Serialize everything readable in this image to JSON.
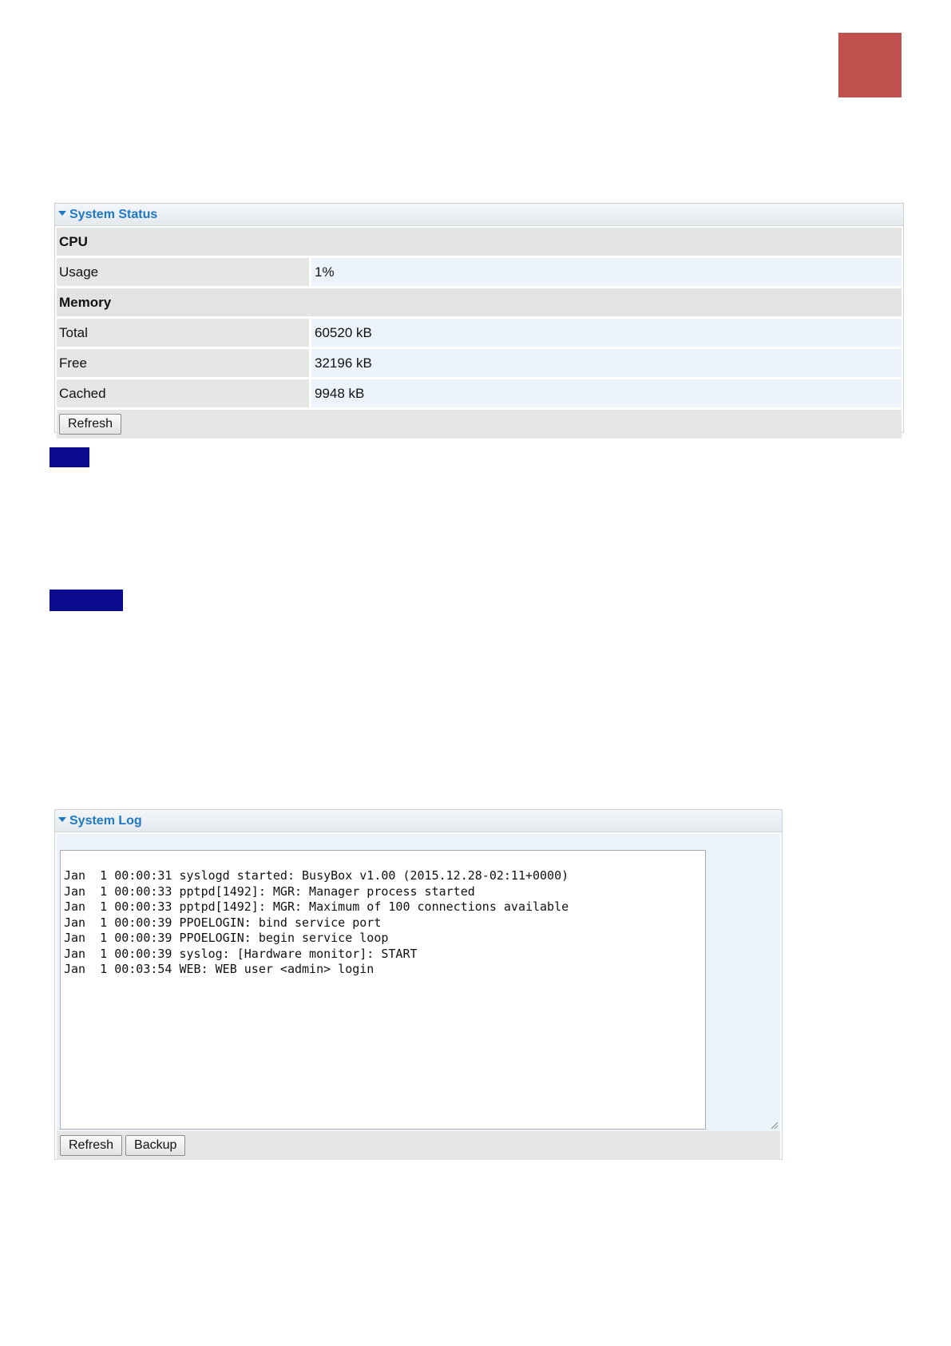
{
  "status_panel": {
    "title": "System Status",
    "cpu": {
      "section_label": "CPU",
      "usage_label": "Usage",
      "usage_value": "1%"
    },
    "memory": {
      "section_label": "Memory",
      "rows": [
        {
          "label": "Total",
          "value": "60520 kB"
        },
        {
          "label": "Free",
          "value": "32196 kB"
        },
        {
          "label": "Cached",
          "value": "9948 kB"
        }
      ]
    },
    "refresh_label": "Refresh"
  },
  "log_panel": {
    "title": "System Log",
    "log_text": "Jan  1 00:00:31 syslogd started: BusyBox v1.00 (2015.12.28-02:11+0000)\nJan  1 00:00:33 pptpd[1492]: MGR: Manager process started\nJan  1 00:00:33 pptpd[1492]: MGR: Maximum of 100 connections available\nJan  1 00:00:39 PPOELOGIN: bind service port\nJan  1 00:00:39 PPOELOGIN: begin service loop\nJan  1 00:00:39 syslog: [Hardware monitor]: START\nJan  1 00:03:54 WEB: WEB user <admin> login",
    "refresh_label": "Refresh",
    "backup_label": "Backup"
  },
  "colors": {
    "corner_block": "#c0504d",
    "highlight_bar": "#0a0a8c",
    "panel_title": "#1f78c4"
  }
}
